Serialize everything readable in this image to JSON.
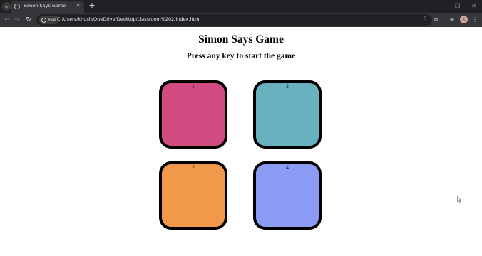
{
  "browser": {
    "tab": {
      "title": "Simon Says Game",
      "close_glyph": "✕"
    },
    "tab_list_glyph": "⌄",
    "new_tab_glyph": "+",
    "window_controls": {
      "minimize": "–",
      "restore": "❐",
      "close": "✕"
    },
    "nav": {
      "back": "←",
      "forward": "→",
      "reload": "↻"
    },
    "site_chip_label": "File",
    "url": "C:/Users/khush/OneDrive/Desktop/classroom%202/index.html",
    "star_glyph": "☆",
    "extensions_glyph": "⧉",
    "media_glyph": "≡",
    "avatar_initial": "k",
    "menu_glyph": "⋮"
  },
  "game": {
    "title": "Simon Says Game",
    "status": "Press any key to start the game",
    "pads": [
      {
        "label": "1",
        "color": "#d14a80"
      },
      {
        "label": "2",
        "color": "#f0994a"
      },
      {
        "label": "3",
        "color": "#69b1bf"
      },
      {
        "label": "4",
        "color": "#8c9cf5"
      }
    ]
  },
  "colors": {
    "chrome_dark": "#202124",
    "chrome_toolbar": "#35363a",
    "page_background": "#ffffff"
  }
}
